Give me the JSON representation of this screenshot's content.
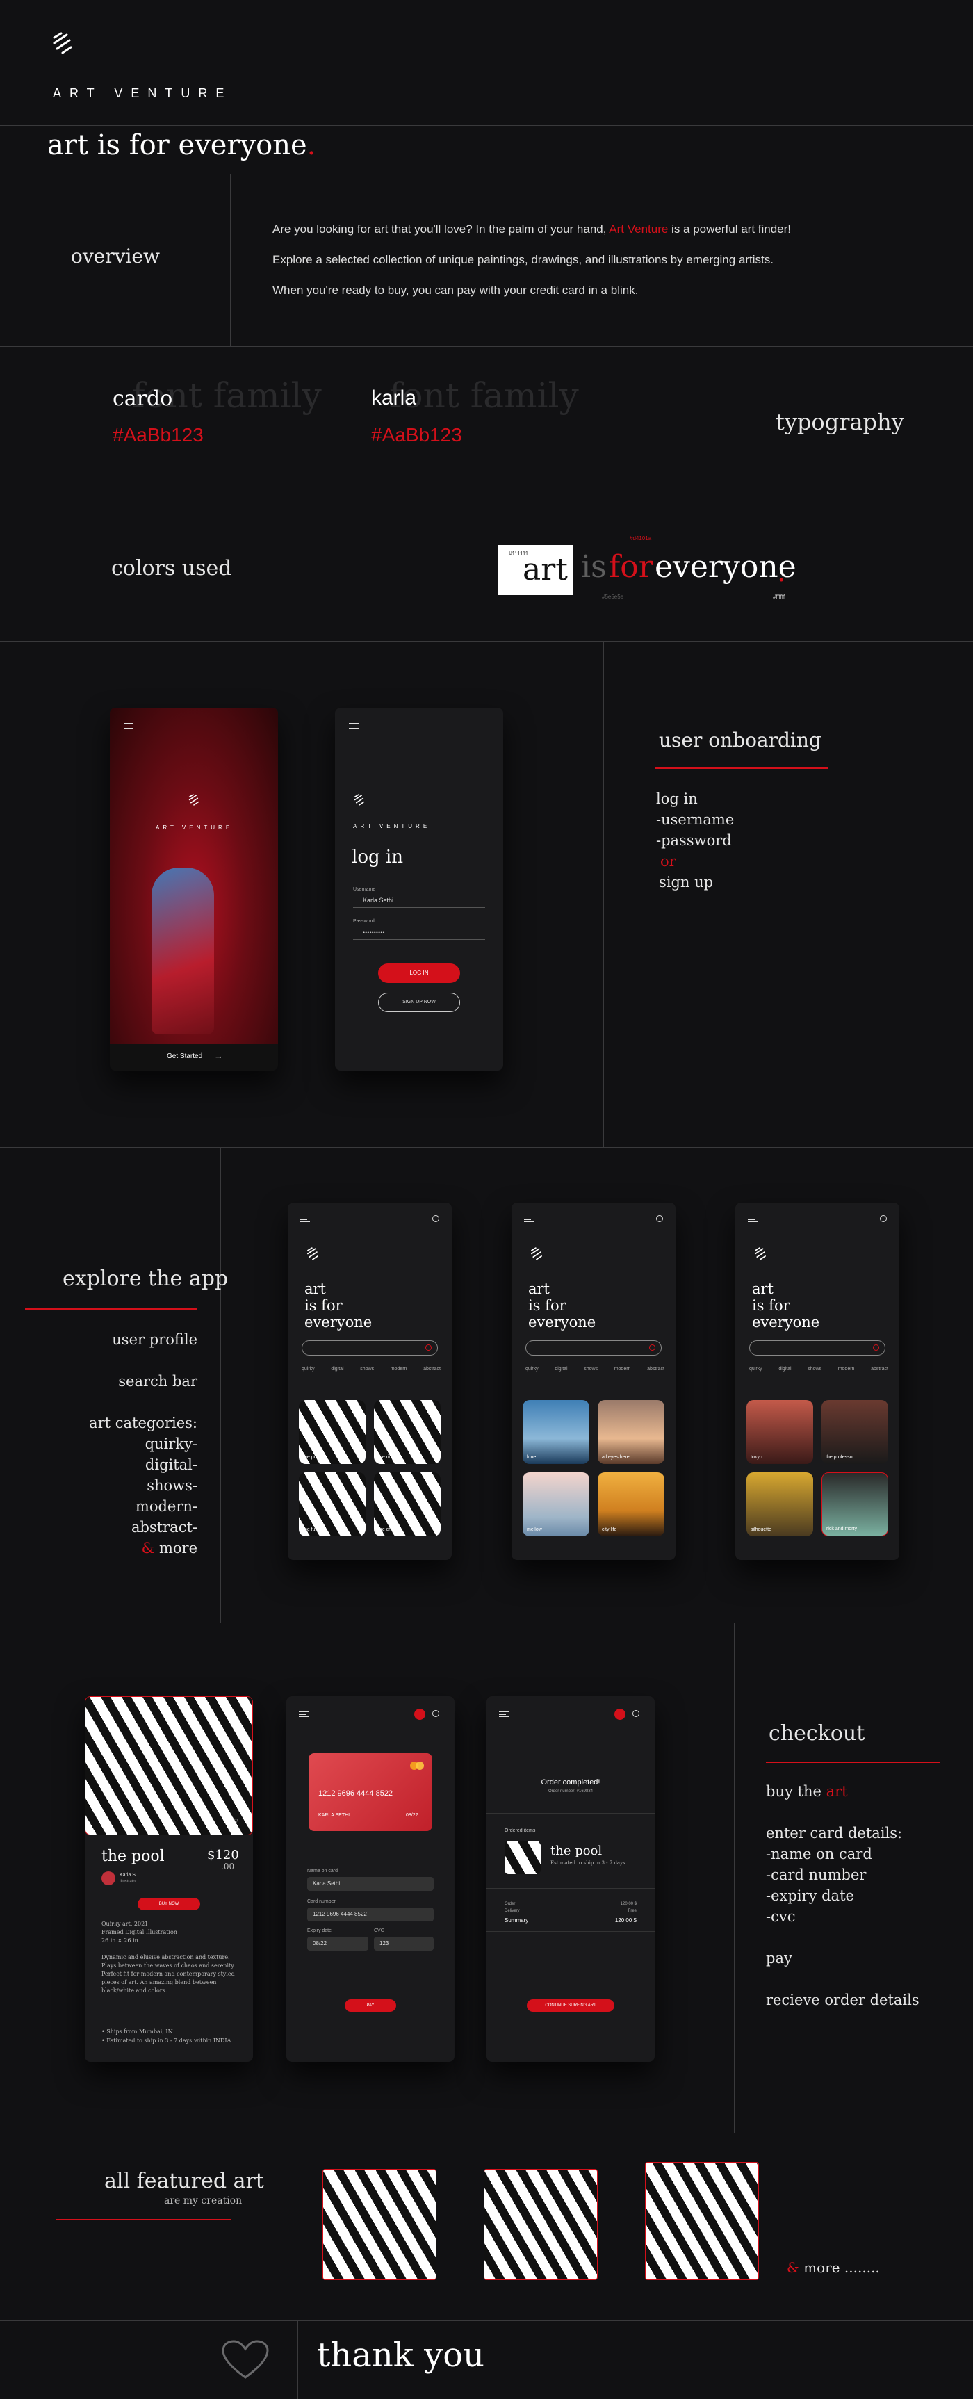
{
  "brand": {
    "name": "ART VENTURE",
    "tagline": "art is for everyone",
    "tagline_dot": "."
  },
  "overview": {
    "heading": "overview",
    "line1a": "Are you looking for art that you'll love? In the palm of your hand, ",
    "line1_brand": "Art Venture",
    "line1b": " is a powerful art finder!",
    "line2": "Explore a selected collection of unique paintings, drawings, and illustrations by emerging artists.",
    "line3": "When you're ready to buy, you can pay with your credit card in a blink."
  },
  "typography": {
    "heading": "typography",
    "font1_name": "cardo",
    "font1_ghost": "font family",
    "font1_color": "#AaBb123",
    "font2_name": "karla",
    "font2_ghost": "font family",
    "font2_color": "#AaBb123"
  },
  "colors": {
    "heading": "colors used",
    "swatch_label": "#111111",
    "word_art": "art",
    "word_is": "is",
    "word_for": "for",
    "word_everyone": "everyone",
    "dot": ".",
    "label_red": "#d4101a",
    "label_gray": "#5e5e5e",
    "label_white": "#ffffff",
    "accent": "#d4101a",
    "bg": "#111111"
  },
  "onboarding": {
    "heading": "user onboarding",
    "list": [
      "log in",
      "-username",
      "-password"
    ],
    "or": "or",
    "signup": "sign up",
    "brand": "ART VENTURE",
    "get_started": "Get Started",
    "arrow": "→",
    "login_title": "log in",
    "username_label": "Username",
    "username_value": "Karla Sethi",
    "password_label": "Password",
    "password_value": "••••••••••",
    "login_btn": "LOG IN",
    "signup_btn": "SIGN UP NOW"
  },
  "explore": {
    "heading": "explore the app",
    "items": [
      "user profile",
      "search bar",
      "art categories:",
      "quirky-",
      "digital-",
      "shows-",
      "modern-",
      "abstract-"
    ],
    "amp": "&",
    "more": " more",
    "phone_title1": "art",
    "phone_title2": "is for",
    "phone_title3": "everyone",
    "tabs": [
      "quirky",
      "digital",
      "shows",
      "modern",
      "abstract"
    ],
    "tiles1": [
      "the pool",
      "the ride",
      "the fun",
      "the chase"
    ],
    "tiles2": [
      "lone",
      "all eyes here",
      "mellow",
      "city life"
    ],
    "tiles3": [
      "tokyo",
      "the professor",
      "silhouette",
      "rick and morty"
    ]
  },
  "checkout": {
    "heading": "checkout",
    "buy_the": "buy the ",
    "buy_art": "art",
    "details": [
      "enter card details:",
      "-name on card",
      "-card number",
      "-expiry date",
      "-cvc"
    ],
    "pay": "pay",
    "receive": "recieve order details",
    "art_title": "the pool",
    "price": "$120",
    "price_cents": ".00",
    "artist_name": "Karla S",
    "artist_role": "Illustrator",
    "buy_now": "BUY NOW",
    "desc_meta": [
      "Quirky art, 2021",
      "Framed Digital Illustration",
      "26 in × 26 in"
    ],
    "desc_body": [
      "Dynamic and elusive abstraction and texture.",
      "Plays between the waves of chaos and serenity.",
      "Perfect fit for modern and contemporary styled",
      "pieces of art. An amazing blend between",
      "black/white and colors."
    ],
    "bullets": [
      "Ships from Mumbai, IN",
      "Estimated to ship in 3 - 7 days within INDIA"
    ],
    "card_number": "1212  9696  4444  8522",
    "card_name": "KARLA SETHI",
    "card_exp": "08/22",
    "form_name_label": "Name on card",
    "form_name_value": "Karla Sethi",
    "form_num_label": "Card number",
    "form_num_value": "1212  9696  4444  8522",
    "form_exp_label": "Expiry date",
    "form_exp_value": "08/22",
    "form_cvc_label": "CVC",
    "form_cvc_value": "123",
    "pay_btn": "PAY",
    "order_done": "Order completed!",
    "order_no": "Order number: #169834",
    "ordered_items": "Ordered items",
    "order_item": "the pool",
    "order_ship": "Estimated to ship in 3 - 7 days",
    "order_label": "Order",
    "order_val": "120.00 $",
    "delivery_label": "Delivery",
    "delivery_val": "Free",
    "summary_label": "Summary",
    "summary_val": "120.00 $",
    "continue_btn": "CONTINUE SURFING ART"
  },
  "featured": {
    "heading": "all featured art",
    "sub": "are my creation",
    "amp": "&",
    "more": " more ........"
  },
  "footer": {
    "thank_you": "thank you"
  }
}
